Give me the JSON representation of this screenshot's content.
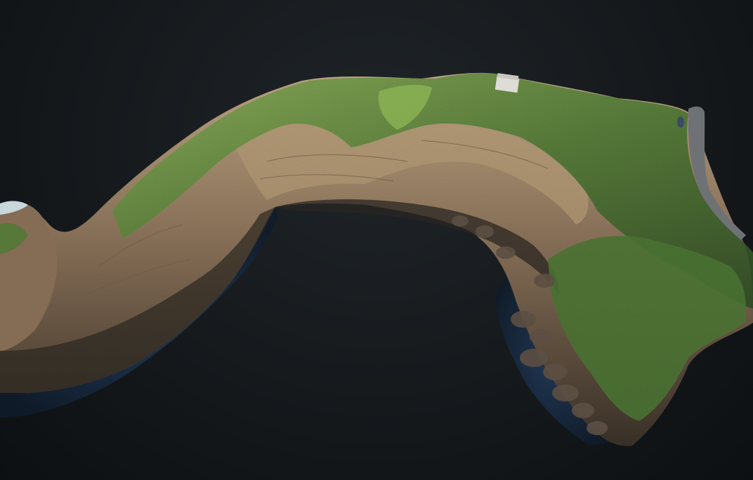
{
  "viewer": {
    "colors": {
      "background": "#15191c",
      "cliff_rock": "#7a6550",
      "cliff_sand": "#b29a78",
      "vegetation": "#4f7a35",
      "vegetation_bright": "#7fa84a",
      "water_shadow": "#1a2f4a",
      "road": "#6d6f72",
      "building": "#d8d6d0"
    },
    "model": "point-cloud-cove"
  }
}
